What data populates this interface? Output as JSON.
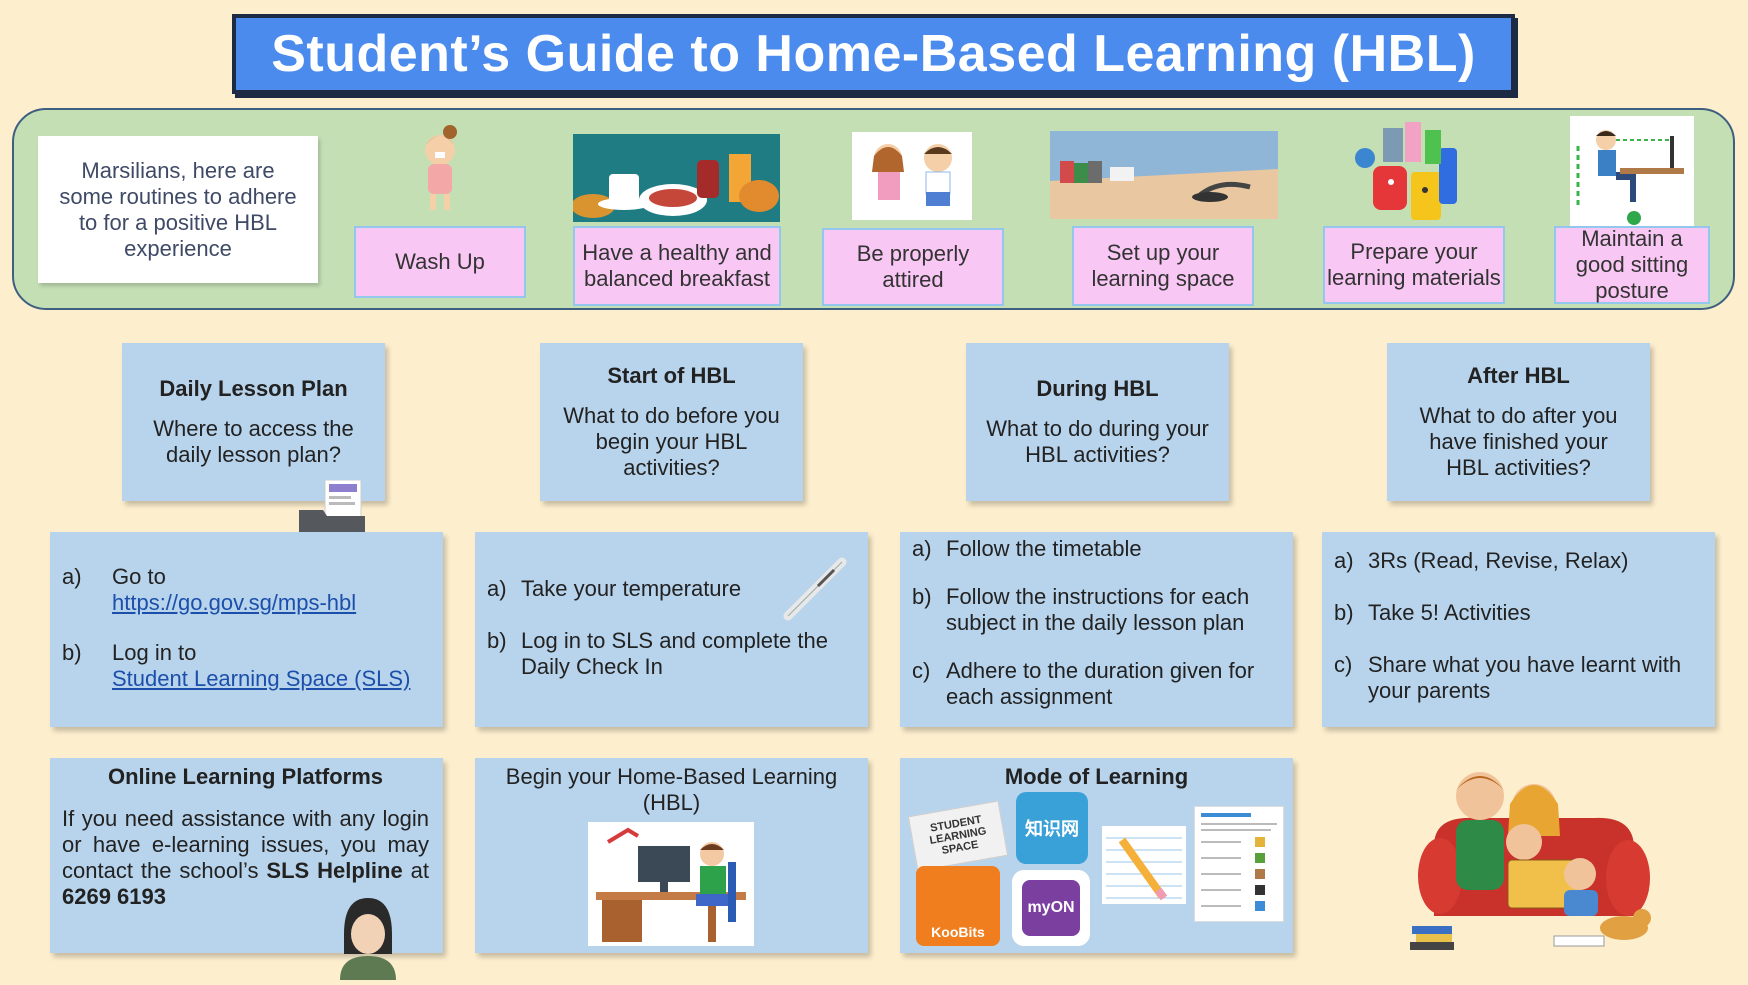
{
  "title": "Student’s Guide to Home-Based Learning (HBL)",
  "routines": {
    "intro": "Marsilians, here are some routines to adhere to for a positive HBL experience",
    "items": [
      {
        "label": "Wash Up",
        "icon": "girl-washing-icon"
      },
      {
        "label": "Have a healthy and balanced breakfast",
        "icon": "breakfast-image"
      },
      {
        "label": "Be properly attired",
        "icon": "children-icon"
      },
      {
        "label": "Set up your learning space",
        "icon": "desk-image"
      },
      {
        "label": "Prepare your learning materials",
        "icon": "stationery-icon"
      },
      {
        "label": "Maintain a good sitting posture",
        "icon": "posture-icon"
      }
    ]
  },
  "sections": {
    "daily": {
      "heading": "Daily Lesson Plan",
      "sub": "Where to access the daily lesson plan?"
    },
    "start": {
      "heading": "Start of HBL",
      "sub": "What to do before you begin your HBL activities?"
    },
    "during": {
      "heading": "During HBL",
      "sub": "What to do during your HBL activities?"
    },
    "after": {
      "heading": "After HBL",
      "sub": "What to do after you have finished your HBL activities?"
    }
  },
  "lists": {
    "daily": [
      {
        "label": "a)",
        "text": "Go to",
        "link": "https://go.gov.sg/mps-hbl"
      },
      {
        "label": "b)",
        "text": "Log in to",
        "link": "Student Learning Space (SLS)"
      }
    ],
    "start": [
      {
        "label": "a)",
        "text": "Take your temperature"
      },
      {
        "label": "b)",
        "text": "Log in to SLS and complete the Daily Check In"
      }
    ],
    "during": [
      {
        "label": "a)",
        "text": "Follow the timetable"
      },
      {
        "label": "b)",
        "text": "Follow the instructions for each subject in the daily lesson plan"
      },
      {
        "label": "c)",
        "text": "Adhere to the duration given for each assignment"
      }
    ],
    "after": [
      {
        "label": "a)",
        "text": "3Rs (Read, Revise, Relax)"
      },
      {
        "label": "b)",
        "text": "Take 5! Activities"
      },
      {
        "label": "c)",
        "text": "Share what you have learnt with your parents"
      }
    ]
  },
  "platforms": {
    "heading": "Online Learning Platforms",
    "text1": "If you need assistance with any login or have e-learning issues, you may contact the school’s",
    "bold1": "SLS Helpline",
    "text2": "at",
    "bold2": "6269 6193"
  },
  "begin": {
    "text": "Begin your Home-Based Learning (HBL)"
  },
  "mode": {
    "heading": "Mode of Learning",
    "logos": {
      "sls": "STUDENT LEARNING SPACE",
      "zhishi": "知识网",
      "koobits": "KooBits",
      "myon": "myON"
    }
  },
  "colors": {
    "background": "#fdefce",
    "title_bg": "#4b8bee",
    "band": "#c5dfb5",
    "routine_box": "#f8c7f4",
    "card": "#b8d4ec"
  }
}
